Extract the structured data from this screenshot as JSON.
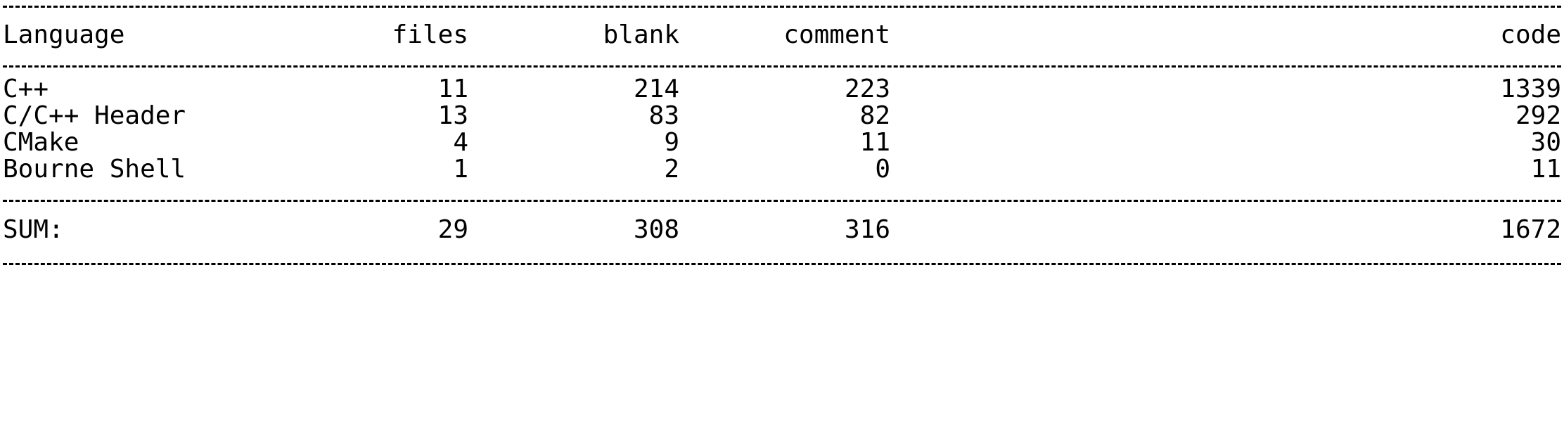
{
  "header": {
    "language": "Language",
    "files": "files",
    "blank": "blank",
    "comment": "comment",
    "code": "code"
  },
  "rows": [
    {
      "language": "C++",
      "files": "11",
      "blank": "214",
      "comment": "223",
      "code": "1339"
    },
    {
      "language": "C/C++ Header",
      "files": "13",
      "blank": "83",
      "comment": "82",
      "code": "292"
    },
    {
      "language": "CMake",
      "files": "4",
      "blank": "9",
      "comment": "11",
      "code": "30"
    },
    {
      "language": "Bourne Shell",
      "files": "1",
      "blank": "2",
      "comment": "0",
      "code": "11"
    }
  ],
  "sum": {
    "language": "SUM:",
    "files": "29",
    "blank": "308",
    "comment": "316",
    "code": "1672"
  }
}
